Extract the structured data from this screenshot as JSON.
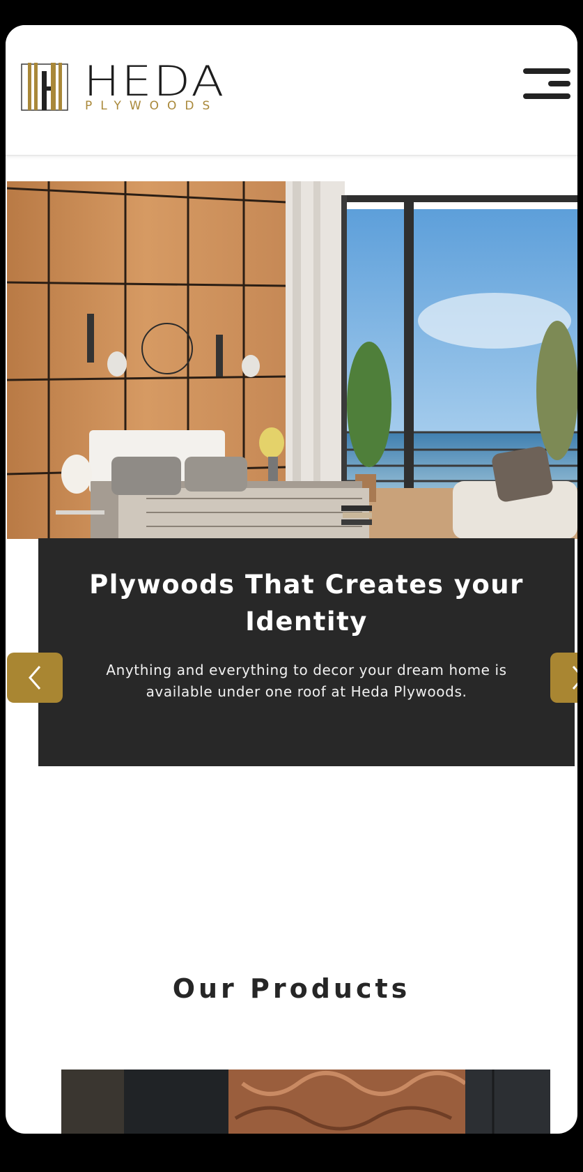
{
  "header": {
    "logo_word": "HEDA",
    "logo_sub": "PLYWOODS",
    "menu_icon": "hamburger-menu-icon"
  },
  "hero": {
    "title": "Plywoods That Creates your Identity",
    "subtitle": "Anything and everything to decor your dream home is available under one roof at Heda Plywoods.",
    "prev_icon": "chevron-left-icon",
    "next_icon": "chevron-right-icon"
  },
  "products": {
    "title": "Our Products"
  },
  "colors": {
    "accent": "#a98632",
    "caption_bg": "#282828",
    "text_dark": "#262626"
  }
}
